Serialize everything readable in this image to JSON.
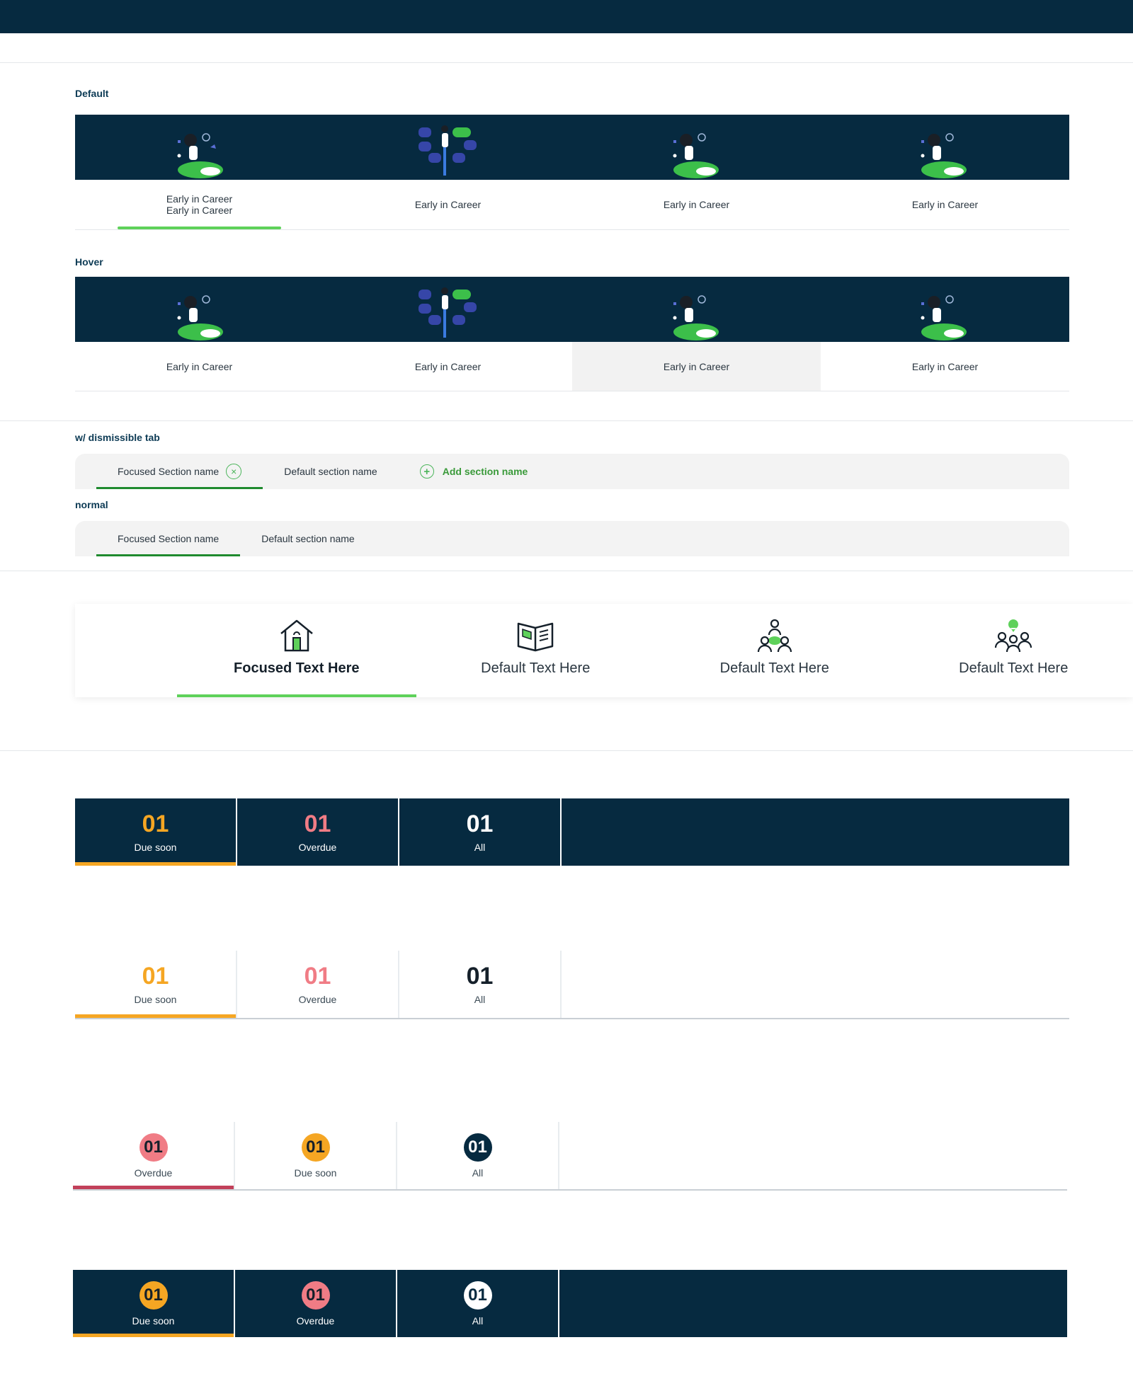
{
  "labels": {
    "default": "Default",
    "hover": "Hover",
    "dismissible": "w/ dismissible tab",
    "normal": "normal"
  },
  "illustrated_default": {
    "tabs": [
      {
        "line1": "Early in Career",
        "line2": "Early in Career",
        "art": "person-on-hill-illustration",
        "focused": true
      },
      {
        "line1": "Early in Career",
        "art": "person-with-tiles-illustration"
      },
      {
        "line1": "Early in Career",
        "art": "person-on-hill-illustration"
      },
      {
        "line1": "Early in Career",
        "art": "person-on-hill-illustration"
      }
    ]
  },
  "illustrated_hover": {
    "tabs": [
      {
        "line1": "Early in Career"
      },
      {
        "line1": "Early in Career"
      },
      {
        "line1": "Early in Career",
        "hovered": true
      },
      {
        "line1": "Early in Career"
      }
    ]
  },
  "dismissible_tabs": {
    "focused": "Focused Section name",
    "default": "Default section name",
    "add": "Add section name"
  },
  "normal_tabs": {
    "focused": "Focused Section name",
    "default": "Default section name"
  },
  "icon_tabs": [
    {
      "label": "Focused Text Here",
      "icon": "home-icon",
      "focused": true
    },
    {
      "label": "Default Text Here",
      "icon": "book-icon"
    },
    {
      "label": "Default Text Here",
      "icon": "group-icon"
    },
    {
      "label": "Default Text Here",
      "icon": "team-icon"
    }
  ],
  "counter_dark": [
    {
      "num": "01",
      "cap": "Due soon",
      "color": "#f5a623",
      "focused": true
    },
    {
      "num": "01",
      "cap": "Overdue",
      "color": "#f07c85"
    },
    {
      "num": "01",
      "cap": "All",
      "color": "#ffffff"
    }
  ],
  "counter_light": [
    {
      "num": "01",
      "cap": "Due soon",
      "color": "#f5a623",
      "focused": true
    },
    {
      "num": "01",
      "cap": "Overdue",
      "color": "#f07c85"
    },
    {
      "num": "01",
      "cap": "All",
      "color": "#15202a"
    }
  ],
  "badge_light": [
    {
      "num": "01",
      "cap": "Overdue",
      "bg": "#f07c85",
      "fg": "#15202a",
      "focused": true,
      "ul": "#c2405a"
    },
    {
      "num": "01",
      "cap": "Due soon",
      "bg": "#f5a623",
      "fg": "#15202a"
    },
    {
      "num": "01",
      "cap": "All",
      "bg": "#062a40",
      "fg": "#ffffff"
    }
  ],
  "badge_dark": [
    {
      "num": "01",
      "cap": "Due soon",
      "bg": "#f5a623",
      "fg": "#15202a",
      "focused": true,
      "ul": "#f5a623"
    },
    {
      "num": "01",
      "cap": "Overdue",
      "bg": "#f07c85",
      "fg": "#15202a"
    },
    {
      "num": "01",
      "cap": "All",
      "bg": "#ffffff",
      "fg": "#062a40"
    }
  ]
}
